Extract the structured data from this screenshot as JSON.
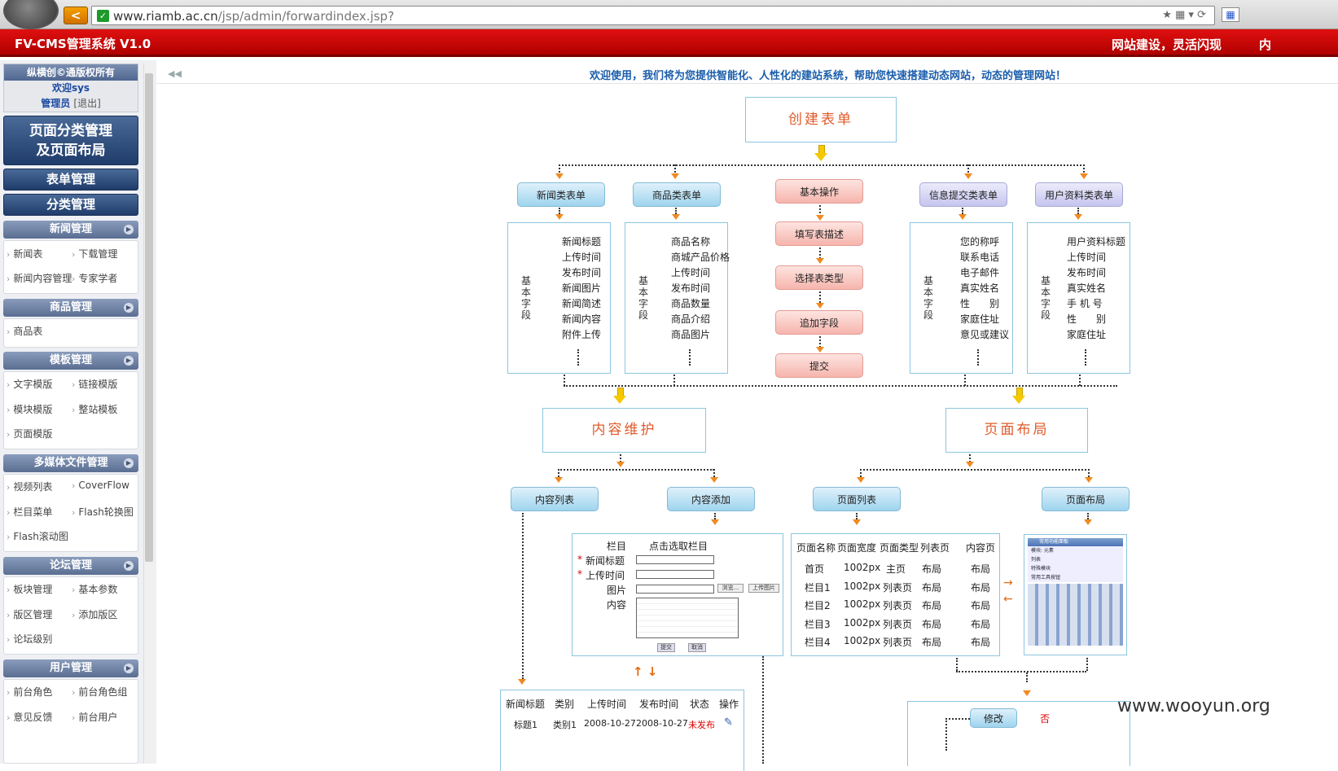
{
  "browser": {
    "url_main": "www.riamb.ac.cn",
    "url_path": "/jsp/admin/forwardindex.jsp?",
    "back_icon": "back-arrow-icon",
    "toolbar_icons": "★ ▦ ▾ ⟳"
  },
  "header": {
    "title": "FV-CMS管理系统 V1.0",
    "slogan": "网站建设，灵活闪现",
    "edge_char": "内"
  },
  "sidebar": {
    "copyright": "纵横创©通版权所有",
    "welcome": "欢迎sys",
    "role": "管理员",
    "logout": "[退出]",
    "big_buttons": [
      "页面分类管理",
      "及页面布局",
      "表单管理",
      "分类管理"
    ],
    "sections": [
      {
        "title": "新闻管理",
        "items": [
          "新闻表",
          "下载管理",
          "新闻内容管理",
          "专家学者"
        ]
      },
      {
        "title": "商品管理",
        "items": [
          "商品表"
        ]
      },
      {
        "title": "模板管理",
        "items": [
          "文字模版",
          "链接模版",
          "模块模版",
          "整站模板",
          "页面模版"
        ]
      },
      {
        "title": "多媒体文件管理",
        "items": [
          "视频列表",
          "CoverFlow",
          "栏目菜单",
          "Flash轮换图",
          "Flash滚动图"
        ]
      },
      {
        "title": "论坛管理",
        "items": [
          "板块管理",
          "基本参数",
          "版区管理",
          "添加版区",
          "论坛级别"
        ]
      },
      {
        "title": "用户管理",
        "items": [
          "前台角色",
          "前台角色组",
          "意见反馈",
          "前台用户"
        ]
      }
    ]
  },
  "main": {
    "welcome": "欢迎使用，我们将为您提供智能化、人性化的建站系统，帮助您快速搭建动态网站，动态的管理网站！",
    "create_form": "创建表单",
    "content_maintain": "内容维护",
    "page_layout": "页面布局",
    "categories": [
      "新闻类表单",
      "商品类表单",
      "基本操作",
      "信息提交类表单",
      "用户资料类表单"
    ],
    "steps": [
      "填写表描述",
      "选择表类型",
      "追加字段",
      "提交"
    ],
    "field_label": "基本字段",
    "news_fields": [
      "新闻标题",
      "上传时间",
      "发布时间",
      "新闻图片",
      "新闻简述",
      "新闻内容",
      "附件上传"
    ],
    "goods_fields": [
      "商品名称",
      "商城产品价格",
      "上传时间",
      "发布时间",
      "商品数量",
      "商品介绍",
      "商品图片"
    ],
    "info_fields": [
      "您的称呼",
      "联系电话",
      "电子邮件",
      "真实姓名",
      "性　　别",
      "家庭住址",
      "意见或建议"
    ],
    "user_fields": [
      "用户资料标题",
      "上传时间",
      "发布时间",
      "真实姓名",
      "手 机 号",
      "性　　别",
      "家庭住址"
    ],
    "sub_buttons": [
      "内容列表",
      "内容添加",
      "页面列表",
      "页面布局"
    ],
    "add_form": {
      "column_label": "栏目",
      "column_value": "点击选取栏目",
      "labels": [
        "新闻标题",
        "上传时间",
        "图片",
        "内容"
      ],
      "browse": "浏览...",
      "upload": "上传图片",
      "submit": "提交",
      "cancel": "取消"
    },
    "page_table": {
      "headers": [
        "页面名称",
        "页面宽度",
        "页面类型",
        "列表页",
        "内容页"
      ],
      "rows": [
        [
          "首页",
          "1002px",
          "主页",
          "布局",
          "布局"
        ],
        [
          "栏目1",
          "1002px",
          "列表页",
          "布局",
          "布局"
        ],
        [
          "栏目2",
          "1002px",
          "列表页",
          "布局",
          "布局"
        ],
        [
          "栏目3",
          "1002px",
          "列表页",
          "布局",
          "布局"
        ],
        [
          "栏目4",
          "1002px",
          "列表页",
          "布局",
          "布局"
        ]
      ]
    },
    "content_table": {
      "headers": [
        "新闻标题",
        "类别",
        "上传时间",
        "发布时间",
        "状态",
        "操作"
      ],
      "row": [
        "标题1",
        "类别1",
        "2008-10-27",
        "2008-10-27",
        "未发布"
      ]
    },
    "edit_button": "修改",
    "edge_char": "否",
    "thumb_title": "常用功能面板",
    "thumb_items": [
      "模块: 元素",
      "列表",
      "特殊模块",
      "常用工具按钮"
    ],
    "updown": "↑ ↓",
    "side_arrows": [
      "→",
      "←"
    ]
  },
  "watermark": "www.wooyun.org"
}
